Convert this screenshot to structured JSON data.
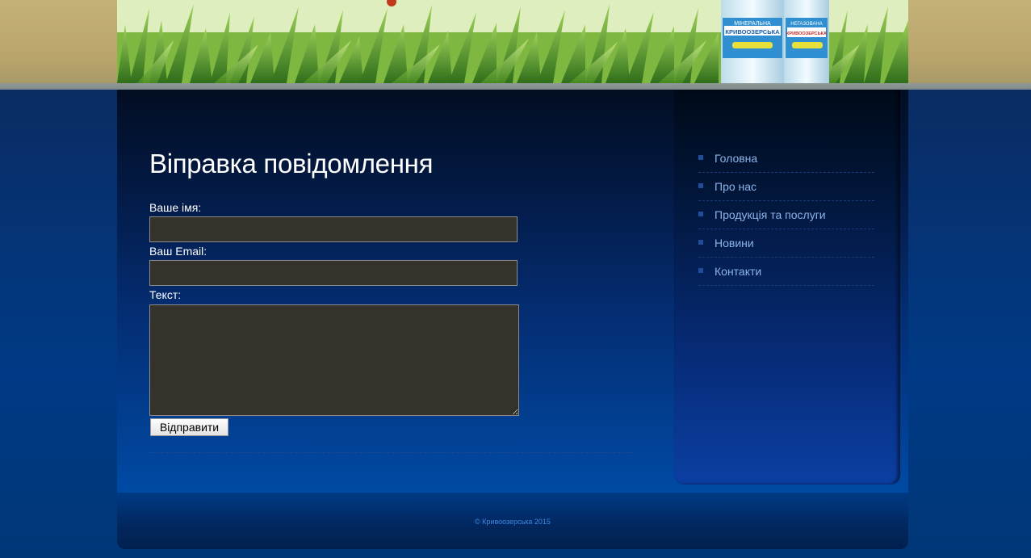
{
  "page": {
    "title": "Віправка повідомлення"
  },
  "form": {
    "name_label": "Ваше імя:",
    "name_value": "",
    "email_label": "Ваш Email:",
    "email_value": "",
    "text_label": "Текст:",
    "text_value": "",
    "submit_label": "Відправити"
  },
  "sidebar": {
    "items": [
      {
        "label": "Головна"
      },
      {
        "label": "Про нас"
      },
      {
        "label": "Продукція та послуги"
      },
      {
        "label": "Новини"
      },
      {
        "label": "Контакти"
      }
    ]
  },
  "header": {
    "bottle_left_brand": "КРИВООЗЕРСЬКА",
    "bottle_left_type": "МІНЕРАЛЬНА",
    "bottle_right_brand": "КРИВООЗЕРСЬКА",
    "bottle_right_type": "НЕГАЗОВАНА"
  },
  "footer": {
    "copyright": "© Кривоозерська 2015"
  },
  "colors": {
    "page_background": "#003a7c",
    "input_background": "#35312b",
    "nav_text": "#8cb4ea",
    "footer_text": "#3f86e0"
  }
}
